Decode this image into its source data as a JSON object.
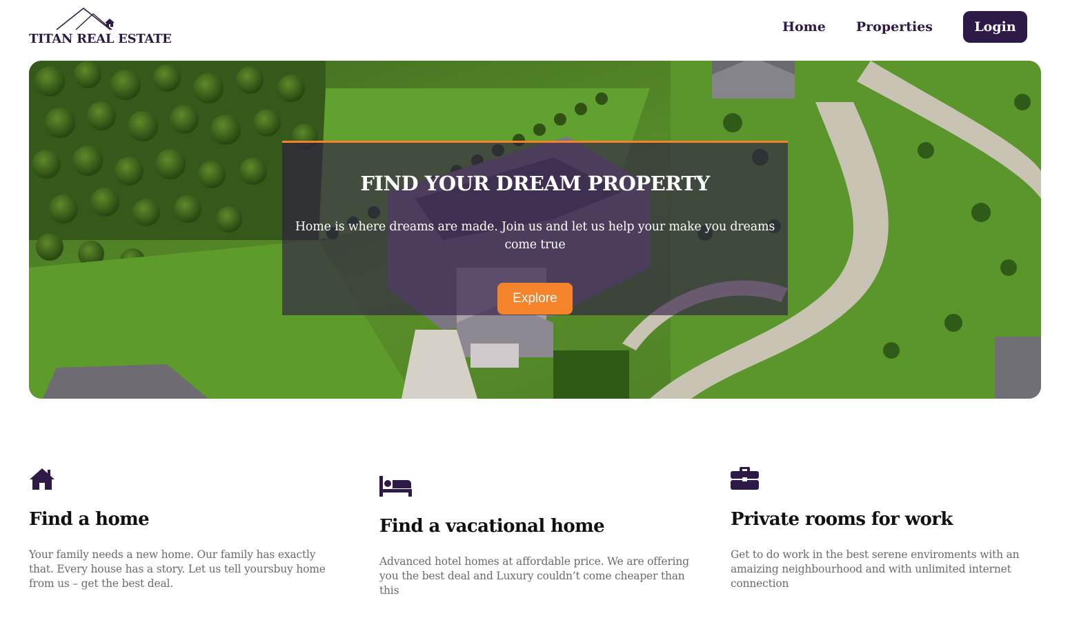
{
  "brand": {
    "name": "TITAN REAL ESTATE",
    "logo_icon": "house-roof-icon"
  },
  "nav": {
    "home_label": "Home",
    "properties_label": "Properties",
    "login_label": "Login"
  },
  "hero": {
    "title": "FIND YOUR DREAM PROPERTY",
    "subtitle": "Home is where dreams are made. Join us and let us help your make you dreams come true",
    "button_label": "Explore"
  },
  "features": [
    {
      "icon": "home-icon",
      "title": "Find a home",
      "text": "Your family needs a new home. Our family has exactly that. Every house has a story. Let us tell yoursbuy home from us – get the best deal."
    },
    {
      "icon": "bed-icon",
      "title": "Find a vacational home",
      "text": "Advanced hotel homes at affordable price. We are offering you the best deal and Luxury couldn’t come cheaper than this"
    },
    {
      "icon": "briefcase-icon",
      "title": "Private rooms for work",
      "text": "Get to do work in the best serene enviroments with an amaizing neighbourhood and with unlimited internet connection"
    }
  ],
  "colors": {
    "primary": "#2e1a47",
    "accent": "#f5832a",
    "text_muted": "#6b6b6b"
  }
}
